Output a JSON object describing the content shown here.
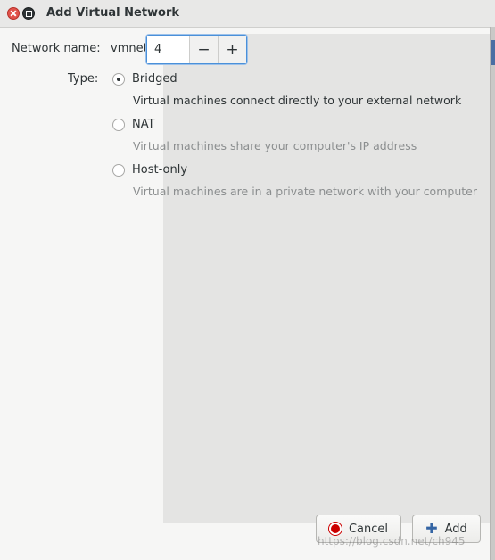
{
  "window": {
    "title": "Add Virtual Network"
  },
  "form": {
    "network_name_label": "Network name:",
    "prefix": "vmnet",
    "value": "4",
    "decrement_symbol": "−",
    "increment_symbol": "+",
    "type_label": "Type:"
  },
  "types": [
    {
      "label": "Bridged",
      "description": "Virtual machines connect directly to your external network",
      "selected": true
    },
    {
      "label": "NAT",
      "description": "Virtual machines share your computer's IP address",
      "selected": false
    },
    {
      "label": "Host-only",
      "description": "Virtual machines are in a private network with your computer",
      "selected": false
    }
  ],
  "buttons": {
    "cancel_label": "Cancel",
    "add_label": "Add"
  },
  "watermark": "https://blog.csdn.net/ch945",
  "colors": {
    "focus_border": "#4a90d9",
    "close_red": "#e0524a",
    "cancel_icon": "#cc0000",
    "add_icon": "#3465a4",
    "muted_text": "#8b8e8f"
  },
  "icons": {
    "close": "close-icon",
    "maximize": "maximize-icon",
    "cancel": "stop-icon",
    "add": "plus-icon"
  }
}
